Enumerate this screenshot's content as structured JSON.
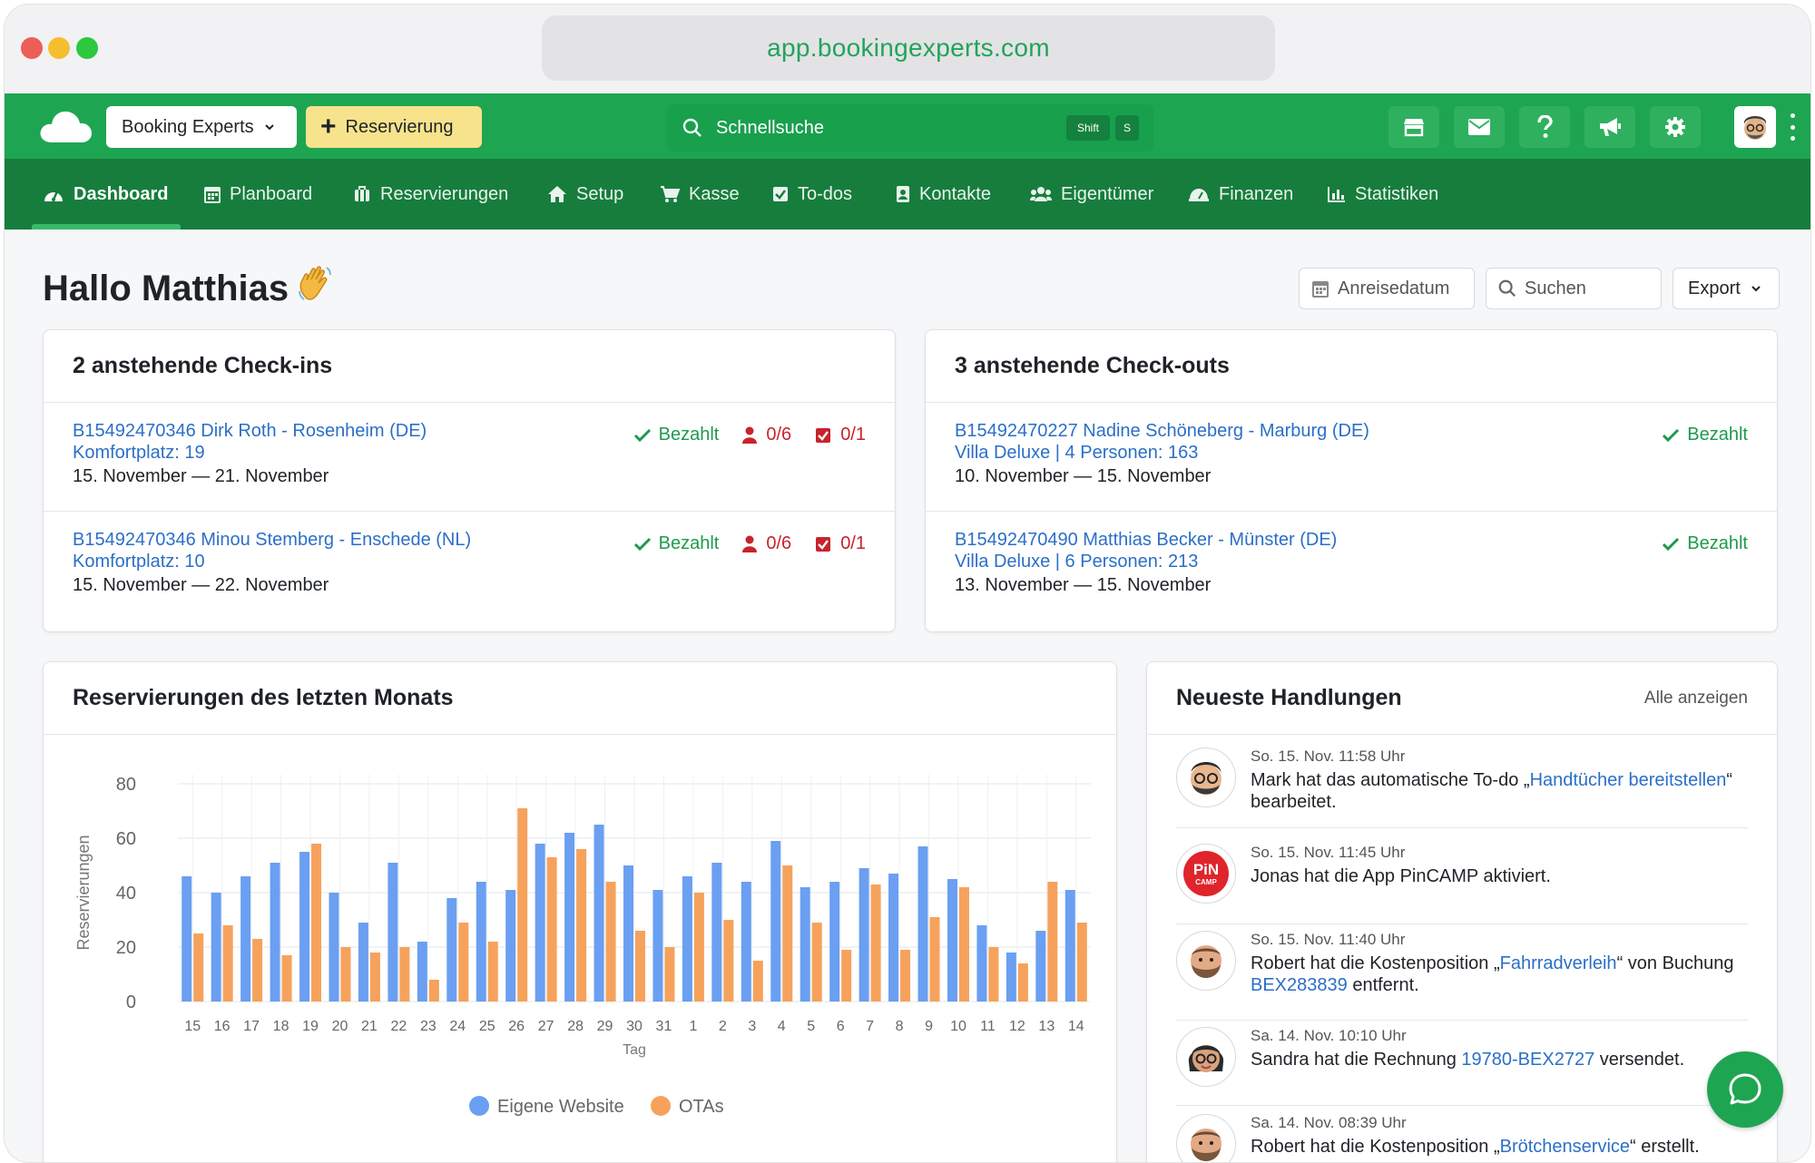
{
  "browser": {
    "url": "app.bookingexperts.com",
    "traffic_lights": [
      "#ec5f57",
      "#f4be2f",
      "#2bc840"
    ]
  },
  "topbar": {
    "account_label": "Booking Experts",
    "reservation_label": "Reservierung",
    "search_placeholder": "Schnellsuche",
    "shortcut_key1": "Shift",
    "shortcut_key2": "S",
    "icons": [
      "store-icon",
      "mail-icon",
      "help-icon",
      "megaphone-icon",
      "settings-icon"
    ],
    "brand_color": "#1ea552"
  },
  "nav": {
    "items": [
      {
        "label": "Dashboard",
        "icon": "dashboard-icon"
      },
      {
        "label": "Planboard",
        "icon": "calendar-icon"
      },
      {
        "label": "Reservierungen",
        "icon": "suitcase-icon"
      },
      {
        "label": "Setup",
        "icon": "home-icon"
      },
      {
        "label": "Kasse",
        "icon": "cart-icon"
      },
      {
        "label": "To-dos",
        "icon": "checkbox-icon"
      },
      {
        "label": "Kontakte",
        "icon": "contact-icon"
      },
      {
        "label": "Eigentümer",
        "icon": "users-icon"
      },
      {
        "label": "Finanzen",
        "icon": "finance-icon"
      },
      {
        "label": "Statistiken",
        "icon": "chart-icon"
      }
    ],
    "active": "Dashboard"
  },
  "page": {
    "greeting": "Hallo Matthias",
    "emoji": "👋",
    "arrival_filter": "Anreisedatum",
    "search_placeholder": "Suchen",
    "export_label": "Export"
  },
  "checkins": {
    "title": "2 anstehende Check-ins",
    "items": [
      {
        "line1": "B15492470346 Dirk Roth - Rosenheim (DE)",
        "line2": "Komfortplatz: 19",
        "dates": "15. November — 21. November",
        "status": "Bezahlt",
        "guests": "0/6",
        "todos": "0/1"
      },
      {
        "line1": "B15492470346 Minou Stemberg - Enschede (NL)",
        "line2": "Komfortplatz: 10",
        "dates": "15. November — 22. November",
        "status": "Bezahlt",
        "guests": "0/6",
        "todos": "0/1"
      }
    ]
  },
  "checkouts": {
    "title": "3 anstehende Check-outs",
    "items": [
      {
        "line1": "B15492470227 Nadine Schöneberg - Marburg (DE)",
        "line2": "Villa Deluxe | 4 Personen: 163",
        "dates": "10. November — 15. November",
        "status": "Bezahlt"
      },
      {
        "line1": "B15492470490 Matthias Becker - Münster (DE)",
        "line2": "Villa Deluxe | 6 Personen: 213",
        "dates": "13. November — 15. November",
        "status": "Bezahlt"
      }
    ]
  },
  "chart_card": {
    "title": "Reservierungen des letzten Monats"
  },
  "chart_data": {
    "type": "bar",
    "xlabel": "Tag",
    "ylabel": "Reservierungen",
    "ylim": [
      0,
      80
    ],
    "yticks": [
      0,
      20,
      40,
      60,
      80
    ],
    "grid": true,
    "legend_position": "bottom",
    "categories": [
      "15",
      "16",
      "17",
      "18",
      "19",
      "20",
      "21",
      "22",
      "23",
      "24",
      "25",
      "26",
      "27",
      "28",
      "29",
      "30",
      "31",
      "1",
      "2",
      "3",
      "4",
      "5",
      "6",
      "7",
      "8",
      "9",
      "10",
      "11",
      "12",
      "13",
      "14"
    ],
    "series": [
      {
        "name": "Eigene Website",
        "color": "#6a9ff2",
        "values": [
          46,
          40,
          46,
          51,
          55,
          40,
          29,
          51,
          22,
          38,
          44,
          41,
          58,
          62,
          65,
          50,
          41,
          46,
          51,
          44,
          59,
          42,
          44,
          49,
          47,
          57,
          45,
          28,
          18,
          26,
          41
        ]
      },
      {
        "name": "OTAs",
        "color": "#f6a25c",
        "values": [
          25,
          28,
          23,
          17,
          58,
          20,
          18,
          20,
          8,
          29,
          22,
          71,
          53,
          56,
          44,
          26,
          20,
          40,
          30,
          15,
          50,
          29,
          19,
          43,
          19,
          31,
          42,
          20,
          14,
          44,
          29
        ]
      }
    ]
  },
  "activity": {
    "title": "Neueste Handlungen",
    "show_all": "Alle anzeigen",
    "items": [
      {
        "time": "So. 15. Nov. 11:58 Uhr",
        "pre": "Mark hat das automatische To-do „",
        "link": "Handtücher bereitstellen",
        "post": "“ bearbeitet.",
        "avatar": "memoji-mark"
      },
      {
        "time": "So. 15. Nov. 11:45 Uhr",
        "pre": "Jonas hat die App PinCAMP aktiviert.",
        "link": "",
        "post": "",
        "avatar": "pincamp-logo",
        "logo_text1": "PiN",
        "logo_text2": "CAMP"
      },
      {
        "time": "So. 15. Nov. 11:40 Uhr",
        "pre": "Robert hat die Kostenposition „",
        "link": "Fahrradverleih",
        "mid": "“ von Buchung ",
        "link2": "BEX283839",
        "post": " entfernt.",
        "avatar": "memoji-robert"
      },
      {
        "time": "Sa. 14. Nov. 10:10 Uhr",
        "pre": "Sandra hat die Rechnung ",
        "link": "19780-BEX2727",
        "post": " versendet.",
        "avatar": "memoji-sandra"
      },
      {
        "time": "Sa. 14. Nov. 08:39 Uhr",
        "pre": "Robert hat die Kostenposition „",
        "link": "Brötchenservice",
        "post": "“ erstellt.",
        "avatar": "memoji-robert"
      }
    ]
  },
  "chat": {
    "icon": "chat-icon"
  }
}
